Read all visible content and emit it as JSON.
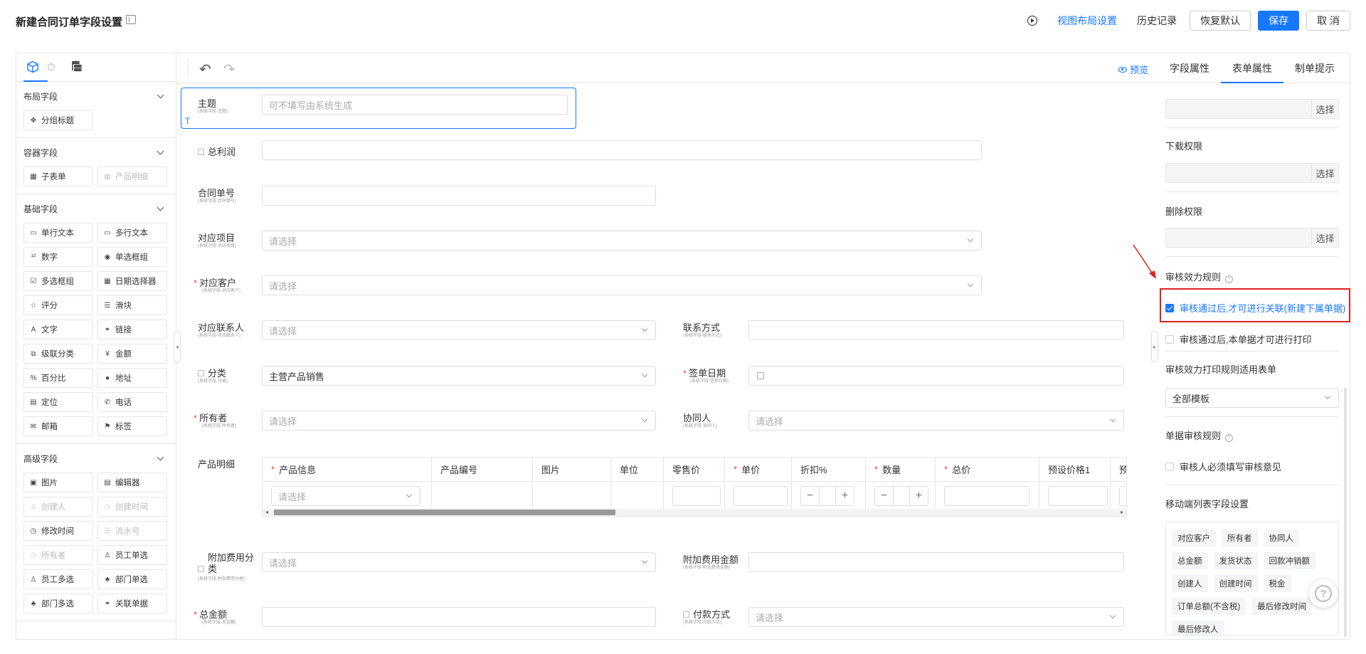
{
  "header": {
    "title": "新建合同订单字段设置",
    "view_layout": "视图布局设置",
    "history": "历史记录",
    "restore": "恢复默认",
    "save": "保存",
    "cancel": "取 消"
  },
  "left_panel": {
    "groups": [
      {
        "title": "布局字段",
        "items": [
          {
            "label": "分组标题",
            "icon": "section-icon",
            "glyph": "✥",
            "disabled": false
          }
        ]
      },
      {
        "title": "容器字段",
        "items": [
          {
            "label": "子表单",
            "icon": "table-icon",
            "glyph": "▦",
            "disabled": false
          },
          {
            "label": "产品明细",
            "icon": "table-icon",
            "glyph": "▦",
            "disabled": true
          }
        ]
      },
      {
        "title": "基础字段",
        "items": [
          {
            "label": "单行文本",
            "icon": "single-line-icon",
            "glyph": "▭",
            "disabled": false
          },
          {
            "label": "多行文本",
            "icon": "multi-line-icon",
            "glyph": "▭",
            "disabled": false
          },
          {
            "label": "数字",
            "icon": "number-icon",
            "glyph": "¹²",
            "disabled": false
          },
          {
            "label": "单选框组",
            "icon": "radio-icon",
            "glyph": "◉",
            "disabled": false
          },
          {
            "label": "多选框组",
            "icon": "checkbox-icon",
            "glyph": "☑",
            "disabled": false
          },
          {
            "label": "日期选择器",
            "icon": "calendar-icon",
            "glyph": "▦",
            "disabled": false
          },
          {
            "label": "评分",
            "icon": "star-icon",
            "glyph": "☆",
            "disabled": false
          },
          {
            "label": "滑块",
            "icon": "slider-icon",
            "glyph": "☰",
            "disabled": false
          },
          {
            "label": "文字",
            "icon": "text-icon",
            "glyph": "A",
            "disabled": false
          },
          {
            "label": "链接",
            "icon": "link-icon",
            "glyph": "⚭",
            "disabled": false
          },
          {
            "label": "级联分类",
            "icon": "cascade-icon",
            "glyph": "⧉",
            "disabled": false
          },
          {
            "label": "金额",
            "icon": "money-icon",
            "glyph": "¥",
            "disabled": false
          },
          {
            "label": "百分比",
            "icon": "percent-icon",
            "glyph": "%",
            "disabled": false
          },
          {
            "label": "地址",
            "icon": "location-pin-icon",
            "glyph": "●",
            "disabled": false
          },
          {
            "label": "定位",
            "icon": "document-icon",
            "glyph": "▤",
            "disabled": false
          },
          {
            "label": "电话",
            "icon": "phone-icon",
            "glyph": "✆",
            "disabled": false
          },
          {
            "label": "邮箱",
            "icon": "mail-icon",
            "glyph": "✉",
            "disabled": false
          },
          {
            "label": "标签",
            "icon": "tag-icon",
            "glyph": "⚑",
            "disabled": false
          }
        ]
      },
      {
        "title": "高级字段",
        "items": [
          {
            "label": "图片",
            "icon": "image-icon",
            "glyph": "▣",
            "disabled": false
          },
          {
            "label": "编辑器",
            "icon": "editor-icon",
            "glyph": "▤",
            "disabled": false
          },
          {
            "label": "创建人",
            "icon": "user-icon",
            "glyph": "♙",
            "disabled": true
          },
          {
            "label": "创建时间",
            "icon": "clock-icon",
            "glyph": "◷",
            "disabled": true
          },
          {
            "label": "修改时间",
            "icon": "clock-icon",
            "glyph": "◷",
            "disabled": false
          },
          {
            "label": "流水号",
            "icon": "list-icon",
            "glyph": "☰",
            "disabled": true
          },
          {
            "label": "所有者",
            "icon": "clock-icon",
            "glyph": "◷",
            "disabled": true
          },
          {
            "label": "员工单选",
            "icon": "user-icon",
            "glyph": "♙",
            "disabled": false
          },
          {
            "label": "员工多选",
            "icon": "users-icon",
            "glyph": "♙",
            "disabled": false
          },
          {
            "label": "部门单选",
            "icon": "department-icon",
            "glyph": "♣",
            "disabled": false
          },
          {
            "label": "部门多选",
            "icon": "department-icon",
            "glyph": "♣",
            "disabled": false
          },
          {
            "label": "关联单据",
            "icon": "link-icon",
            "glyph": "⚭",
            "disabled": false
          }
        ]
      }
    ]
  },
  "center": {
    "preview": "预览",
    "t_badge": "T",
    "subject": {
      "label": "主题",
      "sub": "(系统字段-主题)",
      "placeholder": "可不填写由系统生成"
    },
    "total_profit": {
      "label": "总利润"
    },
    "contract_no": {
      "label": "合同单号",
      "sub": "(系统字段-合同单号)"
    },
    "project": {
      "label": "对应项目",
      "sub": "(系统字段-对应项目)",
      "placeholder": "请选择"
    },
    "customer": {
      "label": "对应客户",
      "sub": "(系统字段-对应客户)",
      "placeholder": "请选择"
    },
    "contact": {
      "label": "对应联系人",
      "sub": "(系统字段-对应联系人)",
      "placeholder": "请选择"
    },
    "contact_info": {
      "label": "联系方式",
      "sub": "(系统字段-联系方式)"
    },
    "category": {
      "label": "分类",
      "sub": "(系统字段-分类)",
      "value": "主营产品销售"
    },
    "sign_date": {
      "label": "签单日期",
      "sub": "(系统字段-签单日期)"
    },
    "owner": {
      "label": "所有者",
      "sub": "(系统字段-所有者)",
      "placeholder": "请选择"
    },
    "collaborator": {
      "label": "协同人",
      "sub": "(系统字段-协同人)",
      "placeholder": "请选择"
    },
    "product_detail": {
      "label": "产品明细",
      "columns": [
        "产品信息",
        "产品编号",
        "图片",
        "单位",
        "零售价",
        "单价",
        "折扣%",
        "数量",
        "总价",
        "预设价格1",
        "预设"
      ],
      "select_placeholder": "请选择",
      "minus": "−",
      "plus": "+"
    },
    "extra_fee_category": {
      "label": "附加费用分类",
      "sub": "(系统字段-附加费用分类)",
      "placeholder": "请选择"
    },
    "extra_fee_amount": {
      "label": "附加费用金额",
      "sub": "(系统字段-附加费用金额)"
    },
    "total_amount": {
      "label": "总金额",
      "sub": "(系统字段-总金额)"
    },
    "payment_method": {
      "label": "付款方式",
      "sub": "(系统字段-付款方式)",
      "placeholder": "请选择"
    }
  },
  "right_panel": {
    "tabs": [
      "字段属性",
      "表单属性",
      "制单提示"
    ],
    "active_tab": "表单属性",
    "select_btn": "选择",
    "download_permission": "下载权限",
    "delete_permission": "删除权限",
    "audit_rule": "审核效力规则",
    "audit_opt1": "审核通过后,才可进行关联(新建下属单据)",
    "audit_opt2": "审核通过后,本单据才可进行打印",
    "print_rule_form": "审核效力打印规则适用表单",
    "print_rule_value": "全部模板",
    "doc_audit_rule": "单据审核规则",
    "doc_audit_opt": "审核人必须填写审核意见",
    "mobile_fields": "移动端列表字段设置",
    "chips": [
      "对应客户",
      "所有者",
      "协同人",
      "总金额",
      "发货状态",
      "回款冲销额",
      "创建人",
      "创建时间",
      "税金",
      "订单总额(不含税)",
      "最后修改时间",
      "最后修改人"
    ]
  },
  "help": "?",
  "colors": {
    "accent": "#1677ff",
    "highlight": "#e02020",
    "required": "#e74c3c"
  }
}
